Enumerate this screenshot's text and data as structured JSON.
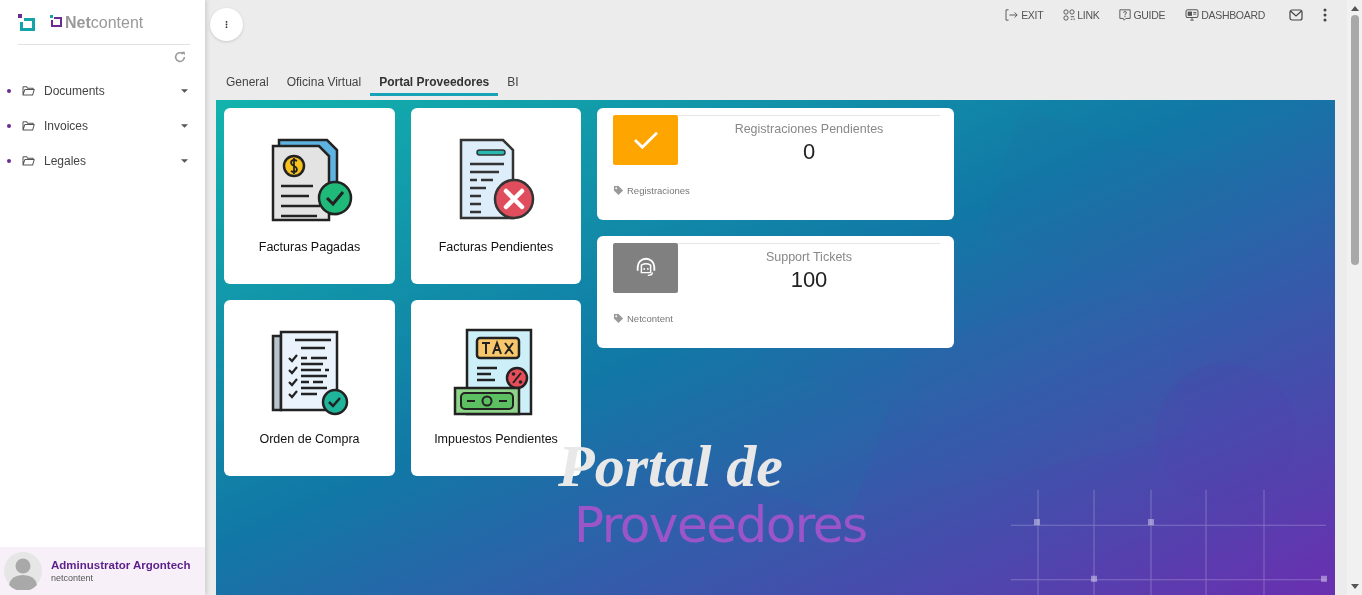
{
  "sidebar": {
    "logo": "**Net**content",
    "items": [
      {
        "label": "Documents"
      },
      {
        "label": "Invoices"
      },
      {
        "label": "Legales"
      }
    ],
    "user": {
      "name": "Adminustrator Argontech",
      "subtitle": "netcontent"
    }
  },
  "topbar": {
    "actions": [
      {
        "kind": "exit",
        "label": "EXIT"
      },
      {
        "kind": "link",
        "label": "LINK"
      },
      {
        "kind": "guide",
        "label": "GUIDE"
      },
      {
        "kind": "dashboard",
        "label": "DASHBOARD"
      }
    ]
  },
  "tabs": [
    {
      "label": "General",
      "selected": false
    },
    {
      "label": "Oficina Virtual",
      "selected": false
    },
    {
      "label": "Portal Proveedores",
      "selected": true
    },
    {
      "label": "BI",
      "selected": false
    }
  ],
  "tiles": [
    {
      "kind": "paid",
      "label": "Facturas Pagadas"
    },
    {
      "kind": "pending",
      "label": "Facturas Pendientes"
    },
    {
      "kind": "order",
      "label": "Orden de Compra"
    },
    {
      "kind": "tax",
      "label": "Impuestos Pendientes"
    }
  ],
  "stats": [
    {
      "kind": "check",
      "color": "#ffa500",
      "title": "Registraciones Pendientes",
      "value": "0",
      "tag": "Registraciones"
    },
    {
      "kind": "headset",
      "color": "#808080",
      "title": "Support Tickets",
      "value": "100",
      "tag": "Netcontent"
    }
  ],
  "banner": {
    "heading": "Portal de",
    "subheading": "Proveedores"
  }
}
